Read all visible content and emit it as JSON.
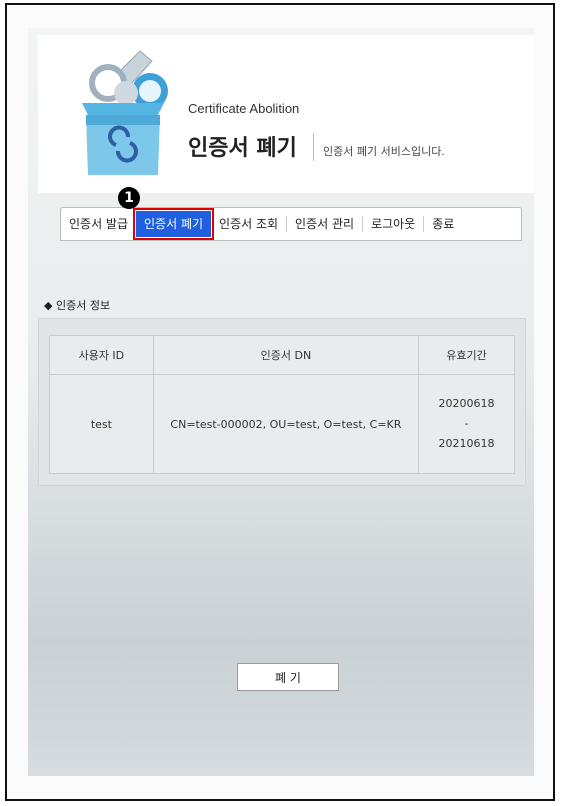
{
  "header": {
    "subtitle": "Certificate Abolition",
    "title": "인증서 폐기",
    "description": "인증서 폐기 서비스입니다."
  },
  "step_badge": "1",
  "tabs": [
    {
      "label": "인증서 발급",
      "active": false
    },
    {
      "label": "인증서 폐기",
      "active": true
    },
    {
      "label": "인증서 조회",
      "active": false
    },
    {
      "label": "인증서 관리",
      "active": false
    },
    {
      "label": "로그아웃",
      "active": false
    },
    {
      "label": "종료",
      "active": false
    }
  ],
  "section": {
    "marker": "◆",
    "title": "인증서 정보"
  },
  "table": {
    "headers": [
      "사용자 ID",
      "인증서 DN",
      "유효기간"
    ],
    "row": {
      "user_id": "test",
      "dn": "CN=test-000002, OU=test, O=test, C=KR",
      "valid_from": "20200618",
      "valid_sep": "-",
      "valid_to": "20210618"
    }
  },
  "button": {
    "label": "폐 기"
  },
  "colors": {
    "active_tab": "#1f5fe0",
    "highlight": "#e00000"
  }
}
